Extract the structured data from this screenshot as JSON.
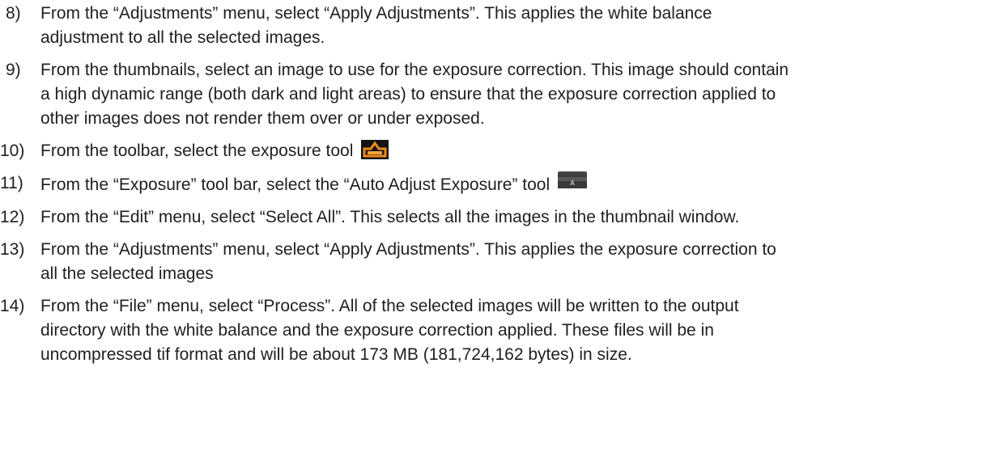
{
  "steps": [
    {
      "number": "8)",
      "lines": [
        "From the “Adjustments” menu, select “Apply Adjustments”. This applies the white balance",
        "adjustment to all the selected images."
      ]
    },
    {
      "number": "9)",
      "lines": [
        "From the thumbnails, select an image to use for the exposure correction. This image should contain",
        "a high dynamic range (both dark and light areas) to ensure that the exposure correction applied to",
        "other images does not render them over or under exposed."
      ]
    },
    {
      "number": "10)",
      "lines": [
        "From the toolbar, select the exposure tool"
      ],
      "icon": "exposure-tool-icon"
    },
    {
      "number": "11)",
      "lines": [
        "From the “Exposure” tool bar, select the “Auto Adjust Exposure” tool"
      ],
      "icon": "auto-adjust-exposure-icon",
      "icon_text": "A"
    },
    {
      "number": "12)",
      "lines": [
        "From the “Edit” menu, select “Select All”. This selects all the images in the thumbnail window."
      ]
    },
    {
      "number": "13)",
      "lines": [
        "From the “Adjustments” menu, select “Apply Adjustments”. This applies the exposure correction to",
        "all the selected images"
      ]
    },
    {
      "number": "14)",
      "lines": [
        "From the “File” menu, select “Process”. All of the selected images will be written to the output",
        "directory with the white balance and the exposure correction applied. These files will be in",
        "uncompressed tif format and will be about 173 MB (181,724,162 bytes) in size."
      ]
    }
  ],
  "colors": {
    "text": "#1f1f1f",
    "exposure_icon_bg": "#141414",
    "exposure_icon_accent": "#f08a1a",
    "auto_icon_bg": "#3a3a3a"
  }
}
